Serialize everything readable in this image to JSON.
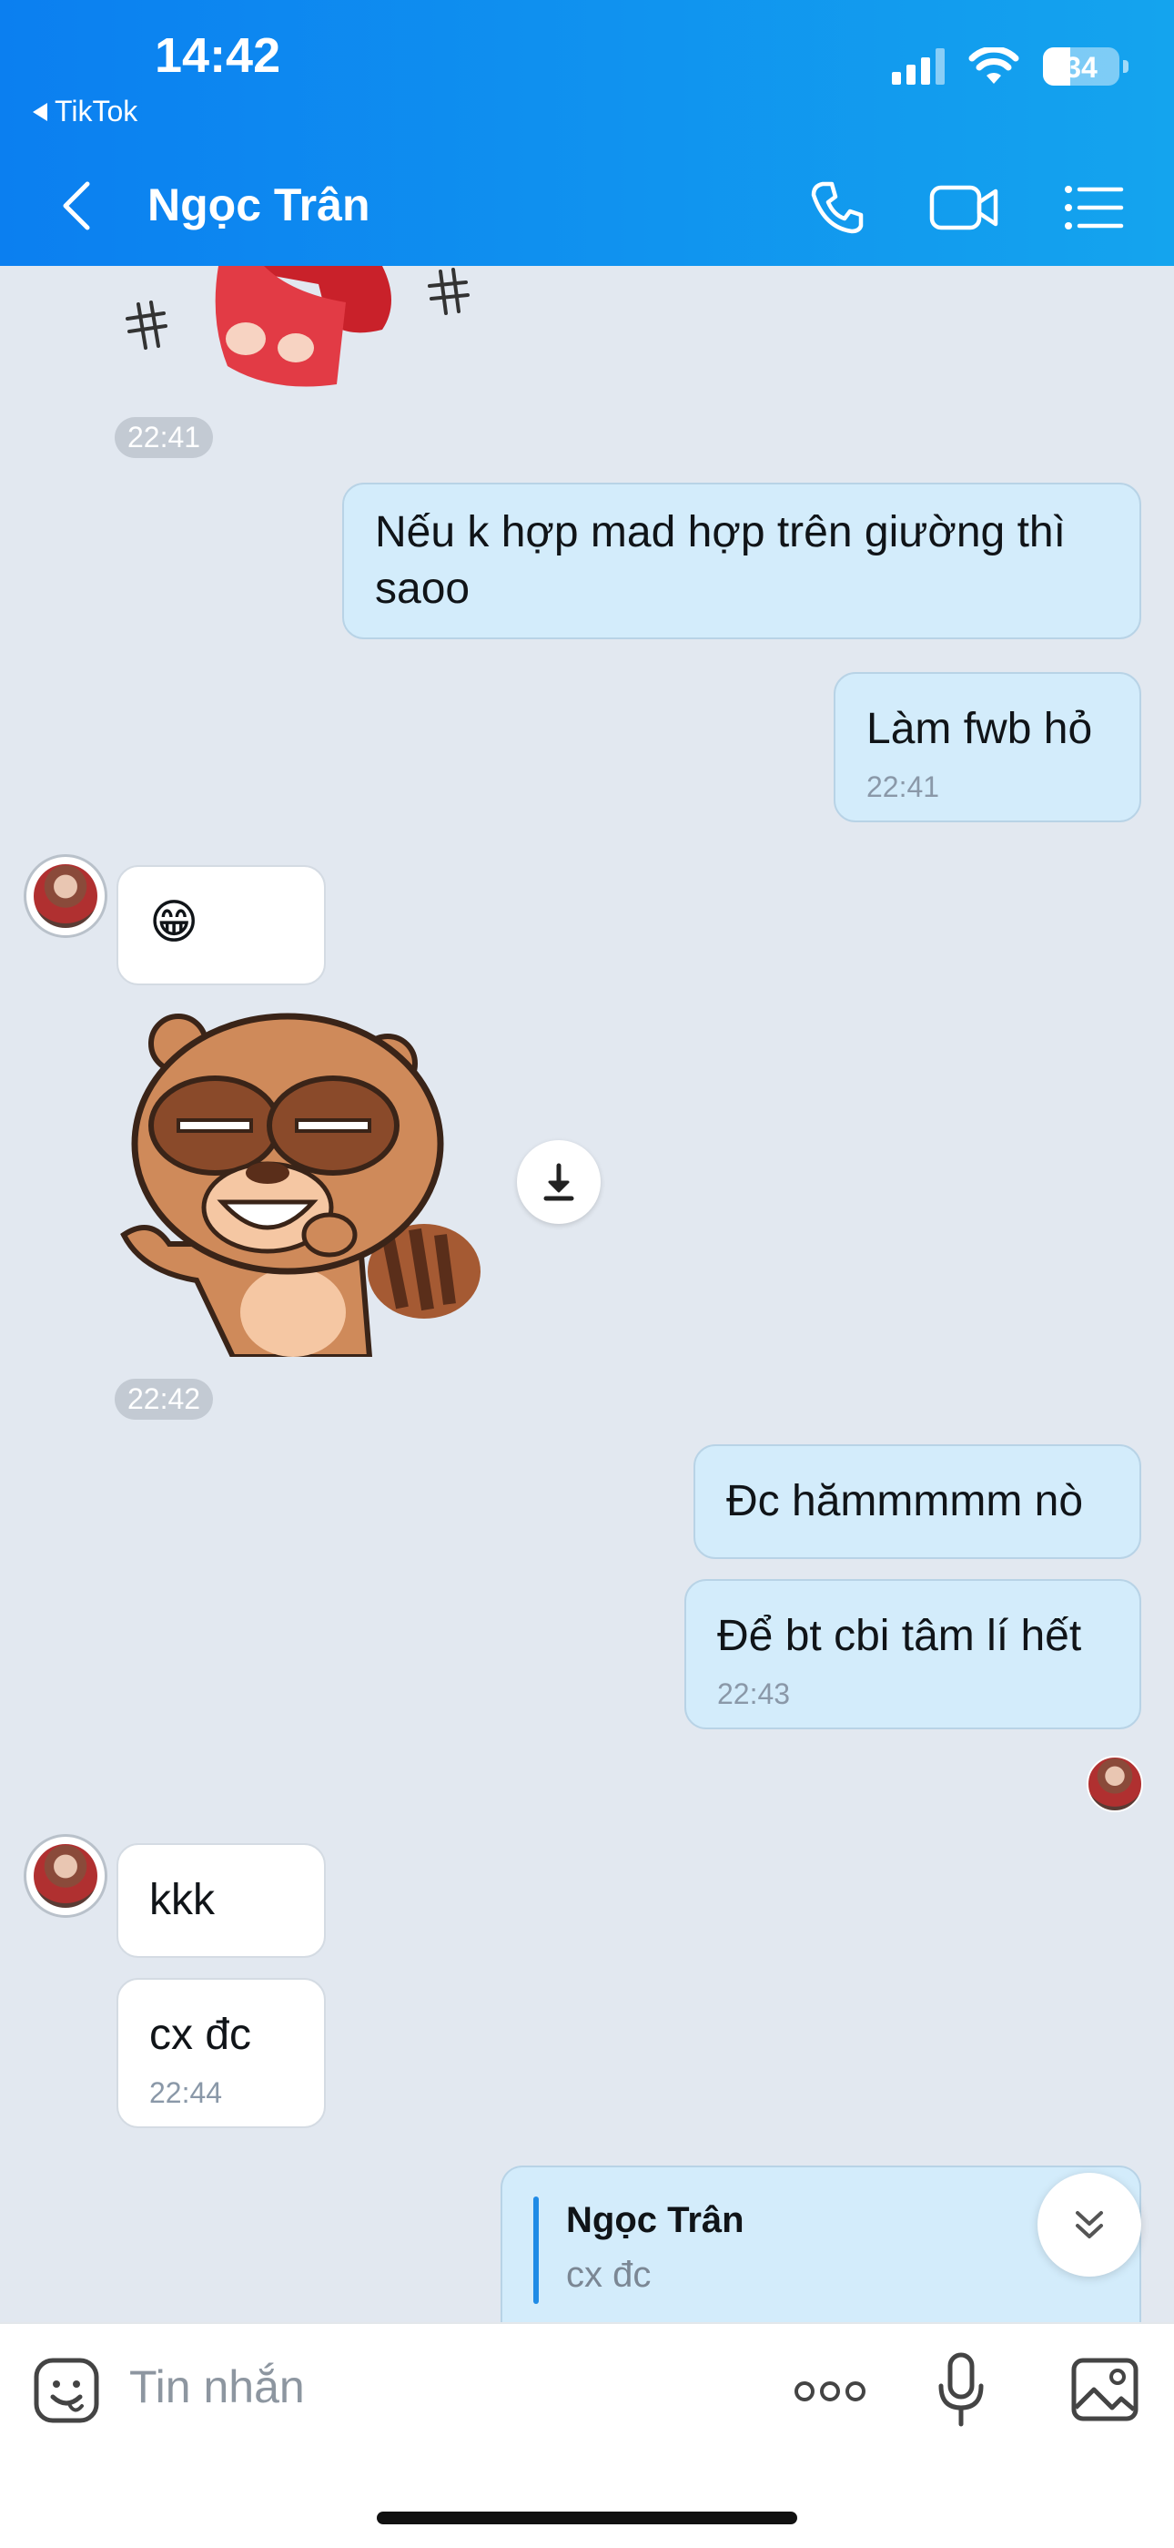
{
  "status_bar": {
    "time": "14:42",
    "back_app": "TikTok",
    "battery": "34"
  },
  "header": {
    "contact_name": "Ngọc Trân"
  },
  "messages": {
    "chip_1": "22:41",
    "out_1": "Nếu k hợp mad hợp trên giường thì saoo",
    "out_2": "Làm fwb hỏ",
    "out_2_time": "22:41",
    "in_emoji": "😁",
    "chip_2": "22:42",
    "out_3": "Đc hămmmmm nò",
    "out_4": "Để bt cbi tâm lí hết",
    "out_4_time": "22:43",
    "in_1": "kkk",
    "in_2": "cx đc",
    "in_2_time": "22:44",
    "reply_quote_name": "Ngọc Trân",
    "reply_quote_text": "cx đc"
  },
  "input": {
    "placeholder": "Tin nhắn"
  },
  "colors": {
    "header_start": "#0b7ff0",
    "header_end": "#14a4ee",
    "out_bubble": "#d3ecfb",
    "in_bubble": "#ffffff",
    "chat_bg": "#e2e8f0"
  }
}
